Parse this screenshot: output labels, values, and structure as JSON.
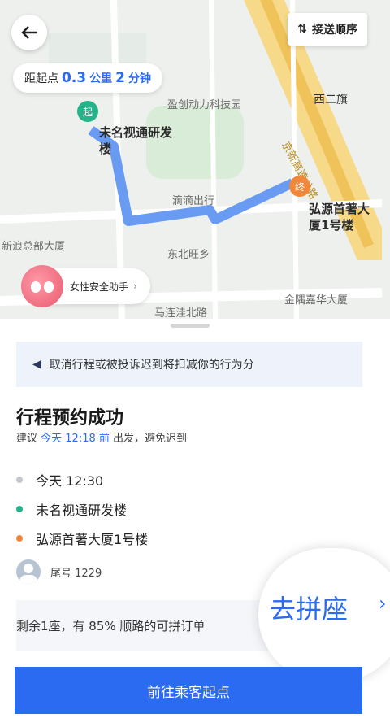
{
  "map": {
    "order_button": "接送顺序",
    "distance": {
      "prefix": "距起点",
      "km": "0.3",
      "km_unit": "公里",
      "min": "2",
      "min_unit": "分钟"
    },
    "start_pin": "起",
    "end_pin": "终",
    "start_label_line1": "未名视通研发",
    "start_label_line2": "楼",
    "end_label_line1": "弘源首著大",
    "end_label_line2": "厦1号楼",
    "pois": [
      "盈创动力科技园",
      "西二旗",
      "滴滴出行",
      "新浪总部大厦",
      "东北旺乡",
      "金隅嘉华大厦",
      "马连洼北路",
      "京新高速公路"
    ],
    "safety_assistant": "女性安全助手"
  },
  "sheet": {
    "notice": "取消行程或被投诉迟到将扣减你的行为分",
    "title": "行程预约成功",
    "subtitle_prefix": "建议",
    "subtitle_time": "今天 12:18 前",
    "subtitle_suffix": "出发，避免迟到",
    "time": "今天 12:30",
    "from": "未名视通研发楼",
    "to": "弘源首著大厦1号楼",
    "passenger_tail": "尾号 1229",
    "carpool_text": "剩余1座，有 85% 顺路的可拼订单",
    "carpool_button": "去拼座",
    "primary_button": "前往乘客起点"
  },
  "colors": {
    "accent": "#2a6bf2",
    "start": "#27b38a",
    "end": "#f0873b",
    "route": "#6a9bf2"
  },
  "icons": [
    "back-arrow-icon",
    "sort-icon",
    "megaphone-icon",
    "clock-icon",
    "chevron-right-icon",
    "avatar-icon"
  ]
}
